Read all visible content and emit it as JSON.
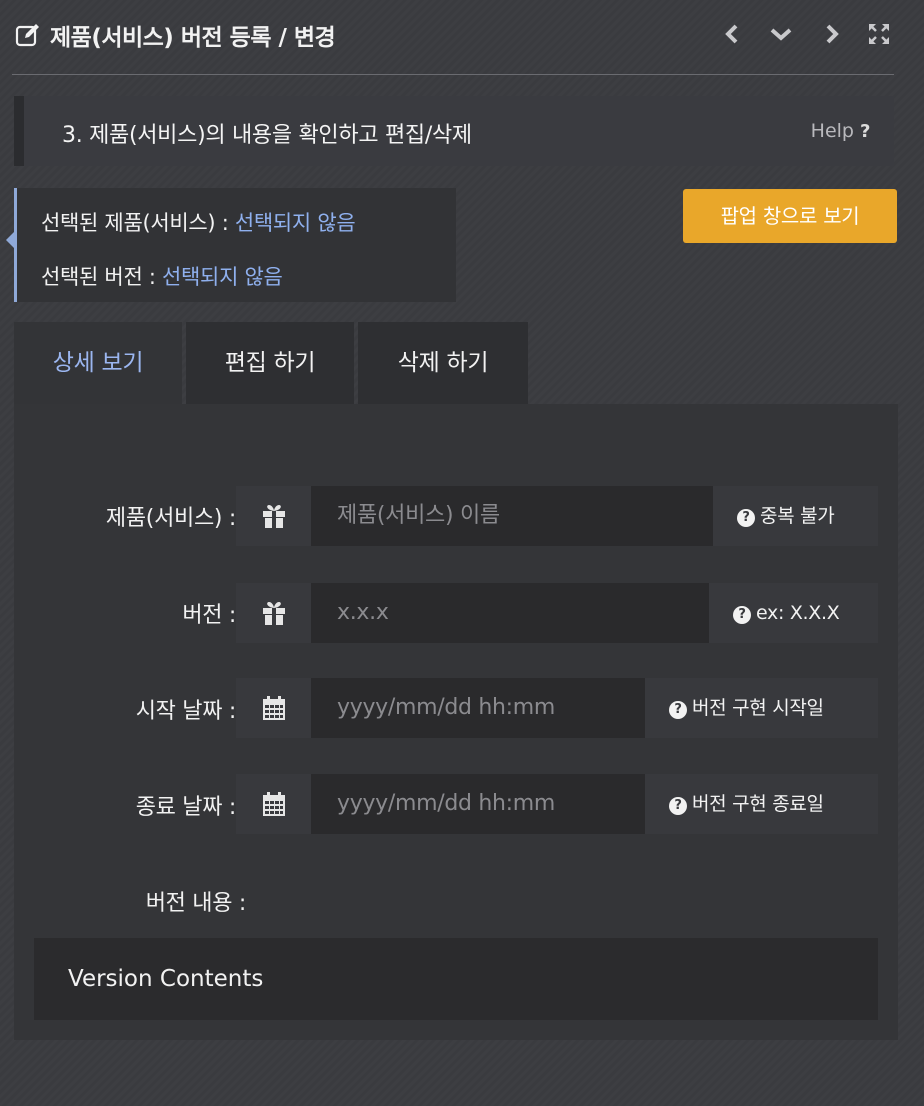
{
  "header": {
    "title": "제품(서비스) 버전 등록 / 변경",
    "icons": [
      "edit-icon",
      "chevron-left-icon",
      "chevron-down-icon",
      "chevron-right-icon",
      "expand-icon"
    ]
  },
  "step": {
    "title": "3. 제품(서비스)의 내용을 확인하고 편집/삭제",
    "help_label": "Help",
    "help_icon": "?"
  },
  "selection": {
    "product_label": "선택된 제품(서비스) : ",
    "product_value": "선택되지 않음",
    "version_label": "선택된 버전 : ",
    "version_value": "선택되지 않음"
  },
  "popup_button": "팝업 창으로 보기",
  "tabs": [
    {
      "label": "상세 보기",
      "active": true
    },
    {
      "label": "편집 하기",
      "active": false
    },
    {
      "label": "삭제 하기",
      "active": false
    }
  ],
  "form": {
    "product": {
      "label": "제품(서비스) :",
      "placeholder": "제품(서비스) 이름",
      "hint": "중복 불가",
      "icon": "gift-icon"
    },
    "version": {
      "label": "버전 :",
      "placeholder": "x.x.x",
      "hint": "ex: X.X.X",
      "icon": "gift-icon"
    },
    "start_date": {
      "label": "시작 날짜 :",
      "placeholder": "yyyy/mm/dd hh:mm",
      "hint": "버전 구현 시작일",
      "icon": "calendar-icon"
    },
    "end_date": {
      "label": "종료 날짜 :",
      "placeholder": "yyyy/mm/dd hh:mm",
      "hint": "버전 구현 종료일",
      "icon": "calendar-icon"
    },
    "contents": {
      "label": "버전 내용 :",
      "value": "Version Contents"
    }
  },
  "colors": {
    "background": "#3b3c40",
    "accent_blue": "#8fb0ee",
    "popup_button": "#e9a72a",
    "input_bg": "#2a2a2c"
  }
}
